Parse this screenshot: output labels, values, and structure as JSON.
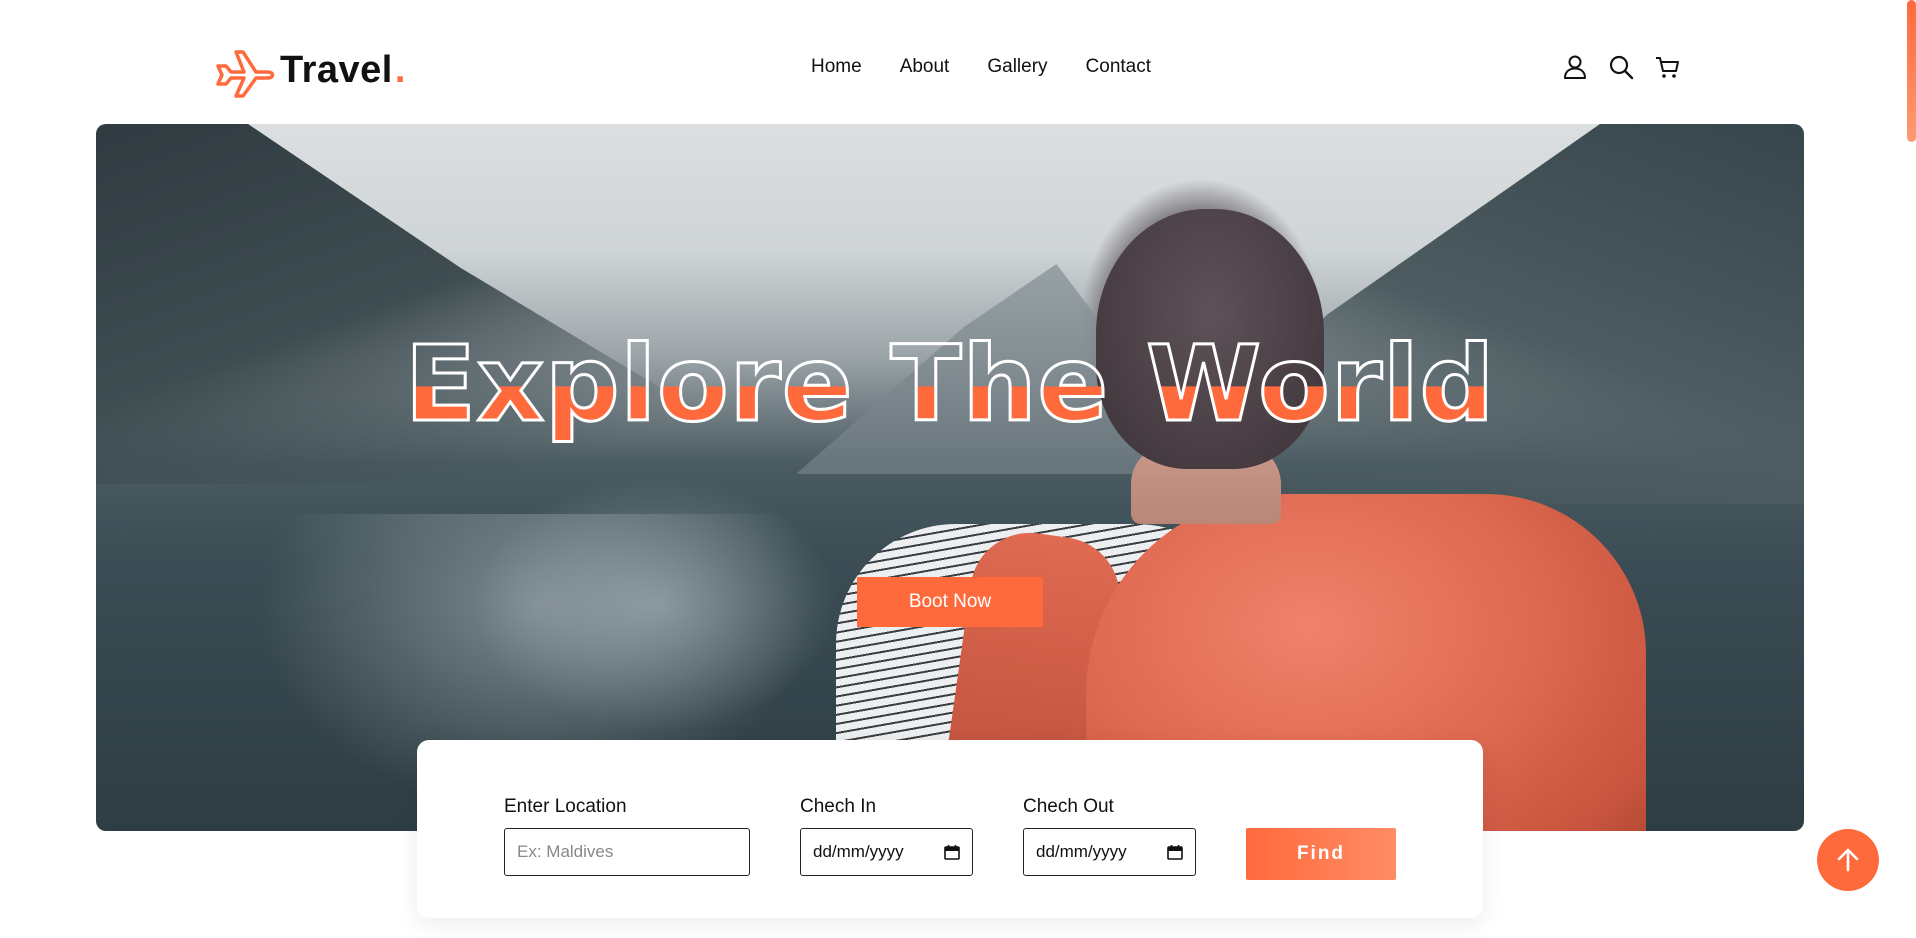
{
  "header": {
    "logo_text": "Travel",
    "logo_dot": ".",
    "nav": [
      "Home",
      "About",
      "Gallery",
      "Contact"
    ],
    "icons": [
      "user-icon",
      "search-icon",
      "cart-icon"
    ]
  },
  "hero": {
    "title": "Explore The World",
    "book_button": "Boot Now"
  },
  "booking": {
    "location_label": "Enter Location",
    "location_placeholder": "Ex: Maldives",
    "checkin_label": "Chech In",
    "checkin_value": "dd/mm/yyyy",
    "checkout_label": "Chech Out",
    "checkout_value": "dd/mm/yyyy",
    "find_button": "Find"
  },
  "colors": {
    "accent": "#ff6a3d",
    "text": "#111111"
  }
}
